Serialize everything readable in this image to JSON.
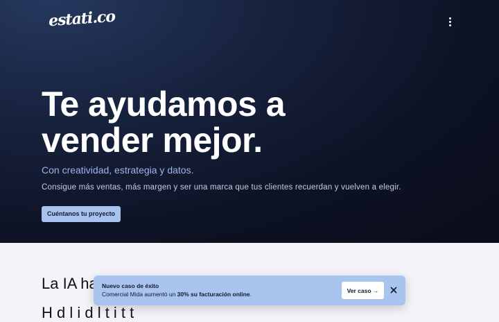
{
  "header": {
    "logo_text": "estati.co",
    "menu_icon": "more-vertical-icon"
  },
  "hero": {
    "headline_line1": "Te ayudamos a",
    "headline_line2": "vender mejor.",
    "subheadline": "Con creatividad, estrategia y datos.",
    "lead": "Consigue más ventas, más margen y ser una marca que tus clientes recuerdan y vuelven a elegir.",
    "cta_label": "Cuéntanos tu proyecto"
  },
  "section": {
    "title_visible": "La IA ha",
    "subtitle_visible": "H   d  l  i       d  l  t        i  t  t"
  },
  "toast": {
    "title": "Nuevo caso de éxito",
    "body_prefix": "Comercial Mida aumentó un ",
    "body_bold": "30% su facturación online",
    "body_suffix": ".",
    "action_label": "Ver caso →",
    "close_icon": "close-icon"
  },
  "colors": {
    "hero_bg": "#0d1224",
    "accent": "#a8c2ee",
    "subheadline": "#9bb7e8",
    "page_bg": "#f3f3f8"
  }
}
